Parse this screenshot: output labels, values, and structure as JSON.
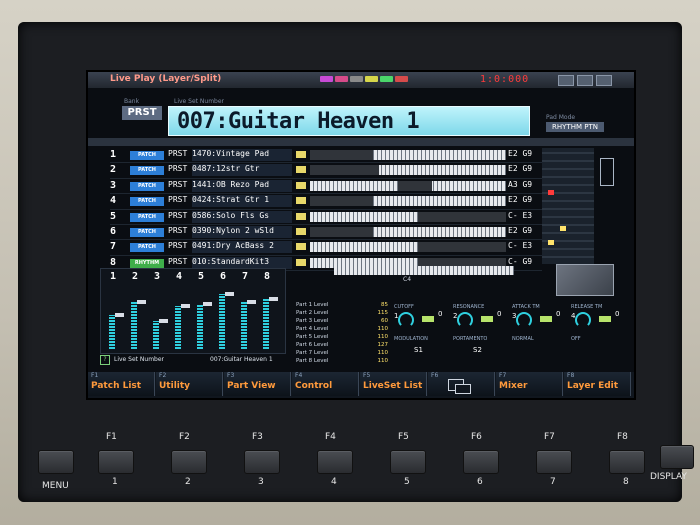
{
  "header": {
    "title": "Live Play (Layer/Split)",
    "time": "1:0:000",
    "tag_colors": [
      "#c84bd6",
      "#d64b8a",
      "#8a8a8a",
      "#d6d64b",
      "#4bd66b",
      "#d64b4b"
    ]
  },
  "bank": {
    "label": "Bank",
    "value": "PRST"
  },
  "live_set_number_label": "Live Set Number",
  "live_set_name": "007:Guitar Heaven 1",
  "pad_mode": {
    "label": "Pad Mode",
    "value": "RHYTHM PTN"
  },
  "parts": [
    {
      "num": "1",
      "type": "PATCH",
      "bank": "PRST",
      "name": "1470:Vintage Pad",
      "range": "E2 G9"
    },
    {
      "num": "2",
      "type": "PATCH",
      "bank": "PRST",
      "name": "0487:12str Gtr",
      "range": "E2 G9"
    },
    {
      "num": "3",
      "type": "PATCH",
      "bank": "PRST",
      "name": "1441:OB Rezo Pad",
      "range": "A3 G9"
    },
    {
      "num": "4",
      "type": "PATCH",
      "bank": "PRST",
      "name": "0424:Strat Gtr 1",
      "range": "E2 G9"
    },
    {
      "num": "5",
      "type": "PATCH",
      "bank": "PRST",
      "name": "0586:Solo Fls Gs",
      "range": "C- E3"
    },
    {
      "num": "6",
      "type": "PATCH",
      "bank": "PRST",
      "name": "0390:Nylon 2 wSld",
      "range": "E2 G9"
    },
    {
      "num": "7",
      "type": "PATCH",
      "bank": "PRST",
      "name": "0491:Dry AcBass 2",
      "range": "C- E3"
    },
    {
      "num": "8",
      "type": "RHYTHM",
      "bank": "PRST",
      "name": "010:StandardKit3",
      "range": "C- G9"
    }
  ],
  "keyboard_marker": "C4",
  "mixer_levels": [
    0.55,
    0.75,
    0.45,
    0.7,
    0.72,
    0.88,
    0.75,
    0.8
  ],
  "mixer_channels": [
    "1",
    "2",
    "3",
    "4",
    "5",
    "6",
    "7",
    "8"
  ],
  "level_list": [
    {
      "name": "Part 1 Level",
      "value": "85"
    },
    {
      "name": "Part 2 Level",
      "value": "115"
    },
    {
      "name": "Part 3 Level",
      "value": "60"
    },
    {
      "name": "Part 4 Level",
      "value": "110"
    },
    {
      "name": "Part 5 Level",
      "value": "110"
    },
    {
      "name": "Part 6 Level",
      "value": "127"
    },
    {
      "name": "Part 7 Level",
      "value": "110"
    },
    {
      "name": "Part 8 Level",
      "value": "110"
    }
  ],
  "controls": [
    {
      "title": "CUTOFF",
      "knob": "1",
      "value": "0"
    },
    {
      "title": "RESONANCE",
      "knob": "2",
      "value": "0"
    },
    {
      "title": "ATTACK TM",
      "knob": "3",
      "value": "0"
    },
    {
      "title": "RELEASE TM",
      "knob": "4",
      "value": "0"
    }
  ],
  "controls2": [
    {
      "title": "MODULATION",
      "value": "S1"
    },
    {
      "title": "PORTAMENTO",
      "value": "S2"
    },
    {
      "title": "NORMAL",
      "value": ""
    },
    {
      "title": "OFF",
      "value": ""
    }
  ],
  "function_keys": [
    {
      "key": "F1",
      "label": "Patch List"
    },
    {
      "key": "F2",
      "label": "Utility"
    },
    {
      "key": "F3",
      "label": "Part View"
    },
    {
      "key": "F4",
      "label": "Control"
    },
    {
      "key": "F5",
      "label": "LiveSet List"
    },
    {
      "key": "F6",
      "label": ""
    },
    {
      "key": "F7",
      "label": "Mixer"
    },
    {
      "key": "F8",
      "label": "Layer Edit"
    }
  ],
  "hardware": {
    "menu": "MENU",
    "display": "DISPLAY",
    "f_labels": [
      "F1",
      "F2",
      "F3",
      "F4",
      "F5",
      "F6",
      "F7",
      "F8"
    ],
    "num_labels": [
      "1",
      "2",
      "3",
      "4",
      "5",
      "6",
      "7",
      "8"
    ]
  }
}
